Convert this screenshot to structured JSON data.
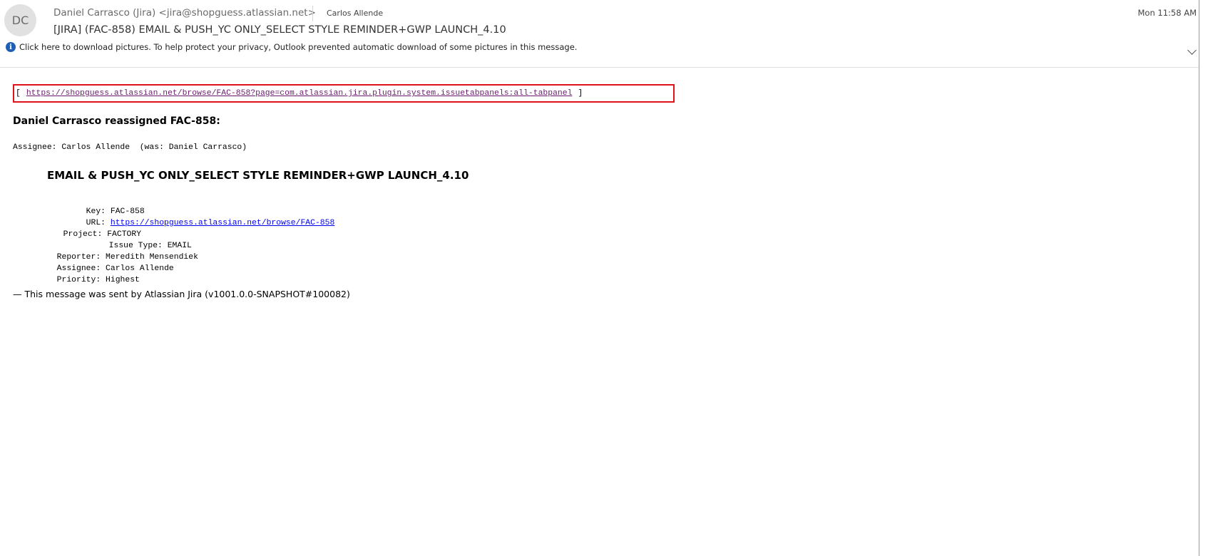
{
  "header": {
    "avatar_initials": "DC",
    "sender": "Daniel Carrasco (Jira) <jira@shopguess.atlassian.net>",
    "to": "Carlos Allende",
    "time": "Mon 11:58 AM",
    "subject": "[JIRA] (FAC-858) EMAIL & PUSH_YC ONLY_SELECT STYLE REMINDER+GWP LAUNCH_4.10",
    "info_bar": "Click here to download pictures. To help protect your privacy, Outlook prevented automatic download of some pictures in this message."
  },
  "body": {
    "bracket_open": "[",
    "top_link": "https://shopguess.atlassian.net/browse/FAC-858?page=com.atlassian.jira.plugin.system.issuetabpanels:all-tabpanel",
    "bracket_close": "]",
    "heading": "Daniel Carrasco reassigned FAC-858:",
    "assignee_change": "Assignee: Carlos Allende  (was: Daniel Carrasco)",
    "issue_title": "EMAIL & PUSH_YC ONLY_SELECT STYLE REMINDER+GWP LAUNCH_4.10",
    "fields": {
      "key_label": "Key:",
      "key_value": "FAC-858",
      "url_label": "URL:",
      "url_value": "https://shopguess.atlassian.net/browse/FAC-858",
      "project_label": "Project:",
      "project_value": "FACTORY",
      "issue_type_label": "Issue Type:",
      "issue_type_value": "EMAIL",
      "reporter_label": "Reporter:",
      "reporter_value": "Meredith Mensendiek",
      "assignee_label": "Assignee:",
      "assignee_value": "Carlos Allende",
      "priority_label": "Priority:",
      "priority_value": "Highest"
    },
    "footer": "— This message was sent by Atlassian Jira (v1001.0.0-SNAPSHOT#100082)"
  },
  "colors": {
    "highlight_border": "#e0121a",
    "link": "#0000ee",
    "visited_link": "#6a1b6d",
    "info_icon": "#1e5fb3"
  },
  "icons": [
    "info-icon",
    "chevron-down-icon"
  ]
}
